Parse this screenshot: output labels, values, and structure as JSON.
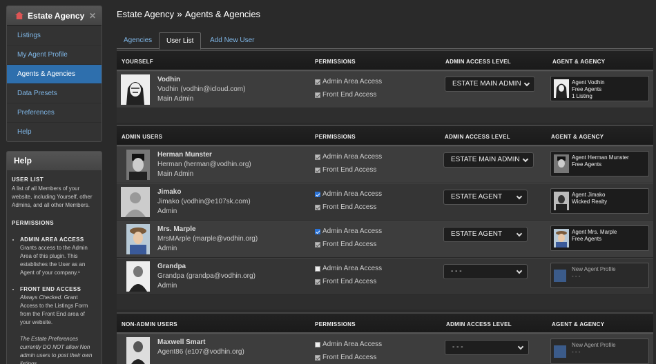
{
  "sidebar": {
    "title": "Estate Agency",
    "items": [
      "Listings",
      "My Agent Profile",
      "Agents & Agencies",
      "Data Presets",
      "Preferences",
      "Help"
    ],
    "active": "Agents & Agencies"
  },
  "help": {
    "title": "Help",
    "user_list_caption": "USER LIST",
    "user_list_text": "A list of all Members of your website, including Yourself, other Admins, and all other Members.",
    "permissions_caption": "PERMISSIONS",
    "admin_access_title": "ADMIN AREA ACCESS",
    "admin_access_text": "Grants access to the Admin Area of this plugin. This establishes the User as an Agent of your company.¹",
    "front_end_title": "FRONT END ACCESS",
    "front_end_text_em": "Always Checked.",
    "front_end_text": " Grant Access to the Listings Form from the Front End area of your website.",
    "note": "The Estate Preferences currently DO NOT allow Non admin users to post their own listings."
  },
  "breadcrumb": {
    "root": "Estate Agency",
    "sep": "»",
    "page": "Agents & Agencies"
  },
  "tabs": [
    "Agencies",
    "User List",
    "Add New User"
  ],
  "active_tab": "User List",
  "columns": {
    "perm": "Permissions",
    "level": "Admin Access Level",
    "agency": "Agent & Agency"
  },
  "perm_labels": {
    "admin": "Admin Area Access",
    "front": "Front End Access"
  },
  "sections": {
    "yourself": "Yourself",
    "admins": "Admin Users",
    "nonadmins": "Non-Admin Users"
  },
  "users": [
    {
      "name": "Vodhin",
      "email": "Vodhin (vodhin@icloud.com)",
      "role": "Main Admin",
      "level": "ESTATE MAIN ADMIN",
      "admin_check": "disabled",
      "front_check": "disabled",
      "agency": [
        "Agent Vodhin",
        "Free Agents",
        "1 Listing"
      ]
    },
    {
      "name": "Herman Munster",
      "email": "Herman (herman@vodhin.org)",
      "role": "Main Admin",
      "level": "ESTATE MAIN ADMIN",
      "admin_check": "disabled",
      "front_check": "disabled",
      "agency": [
        "Agent Herman Munster",
        "Free Agents"
      ]
    },
    {
      "name": "Jimako",
      "email": "Jimako (vodhin@e107sk.com)",
      "role": "Admin",
      "level": "ESTATE AGENT",
      "admin_check": "on",
      "front_check": "disabled",
      "agency": [
        "Agent Jimako",
        "Wicked Realty"
      ]
    },
    {
      "name": "Mrs. Marple",
      "email": "MrsMArple (marple@vodhin.org)",
      "role": "Admin",
      "level": "ESTATE AGENT",
      "admin_check": "on",
      "front_check": "disabled",
      "agency": [
        "Agent Mrs. Marple",
        "Free Agents"
      ]
    },
    {
      "name": "Grandpa",
      "email": "Grandpa (grandpa@vodhin.org)",
      "role": "Admin",
      "level": "- - -",
      "admin_check": "off",
      "front_check": "disabled",
      "agency": [
        "New Agent Profile",
        "- - -"
      ]
    },
    {
      "name": "Maxwell Smart",
      "email": "Agent86 (e107@vodhin.org)",
      "role": "",
      "level": "- - -",
      "admin_check": "off",
      "front_check": "disabled",
      "agency": [
        "New Agent Profile",
        "- - -"
      ]
    }
  ]
}
